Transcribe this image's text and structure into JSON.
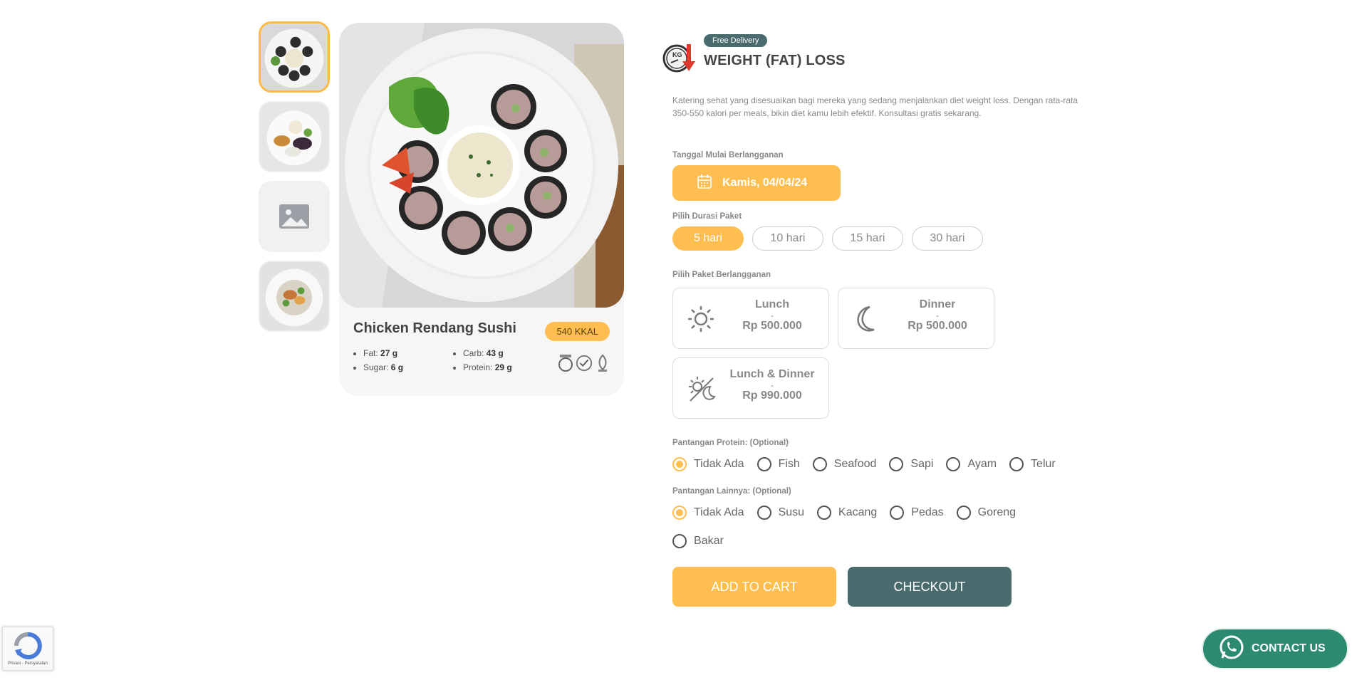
{
  "gallery": {
    "thumbnails": [
      "photo-sushi",
      "photo-side-dishes",
      "image-placeholder",
      "photo-salad"
    ],
    "active_index": 0
  },
  "product": {
    "dish_name": "Chicken Rendang Sushi",
    "kkal": "540 KKAL",
    "nutrition": {
      "fat_label": "Fat:",
      "fat_value": "27 g",
      "sugar_label": "Sugar:",
      "sugar_value": "6 g",
      "carb_label": "Carb:",
      "carb_value": "43 g",
      "protein_label": "Protein:",
      "protein_value": "29 g"
    },
    "certifications": [
      "halal-icon",
      "check-badge-icon",
      "bpom-icon"
    ]
  },
  "package": {
    "badge": "Free Delivery",
    "title": "WEIGHT (FAT) LOSS",
    "description": "Katering sehat yang disesuaikan bagi mereka yang sedang menjalankan diet weight loss. Dengan rata-rata 350-550 kalori per meals, bikin diet kamu lebih efektif. Konsultasi gratis sekarang."
  },
  "start_date": {
    "label": "Tanggal Mulai Berlangganan",
    "value": "Kamis, 04/04/24"
  },
  "duration": {
    "label": "Pilih Durasi Paket",
    "options": [
      "5 hari",
      "10 hari",
      "15 hari",
      "30 hari"
    ],
    "selected": "5 hari"
  },
  "plans": {
    "label": "Pilih Paket Berlangganan",
    "items": [
      {
        "name": "Lunch",
        "dash": "-",
        "price": "Rp 500.000",
        "icon": "sun-icon"
      },
      {
        "name": "Dinner",
        "dash": "-",
        "price": "Rp 500.000",
        "icon": "moon-icon"
      },
      {
        "name": "Lunch & Dinner",
        "dash": "-",
        "price": "Rp 990.000",
        "icon": "sun-moon-icon"
      }
    ]
  },
  "protein_restriction": {
    "label": "Pantangan Protein: (Optional)",
    "options": [
      "Tidak Ada",
      "Fish",
      "Seafood",
      "Sapi",
      "Ayam",
      "Telur"
    ],
    "selected": "Tidak Ada"
  },
  "other_restriction": {
    "label": "Pantangan Lainnya: (Optional)",
    "options": [
      "Tidak Ada",
      "Susu",
      "Kacang",
      "Pedas",
      "Goreng",
      "Bakar"
    ],
    "selected": "Tidak Ada"
  },
  "actions": {
    "add_to_cart": "ADD TO CART",
    "checkout": "CHECKOUT"
  },
  "contact": {
    "label": "CONTACT US"
  },
  "recaptcha": {
    "text": "Privasi - Persyaratan"
  },
  "colors": {
    "accent": "#ffbe4f",
    "primary_dark": "#4a6b6e",
    "whatsapp": "#2b8a6f"
  }
}
